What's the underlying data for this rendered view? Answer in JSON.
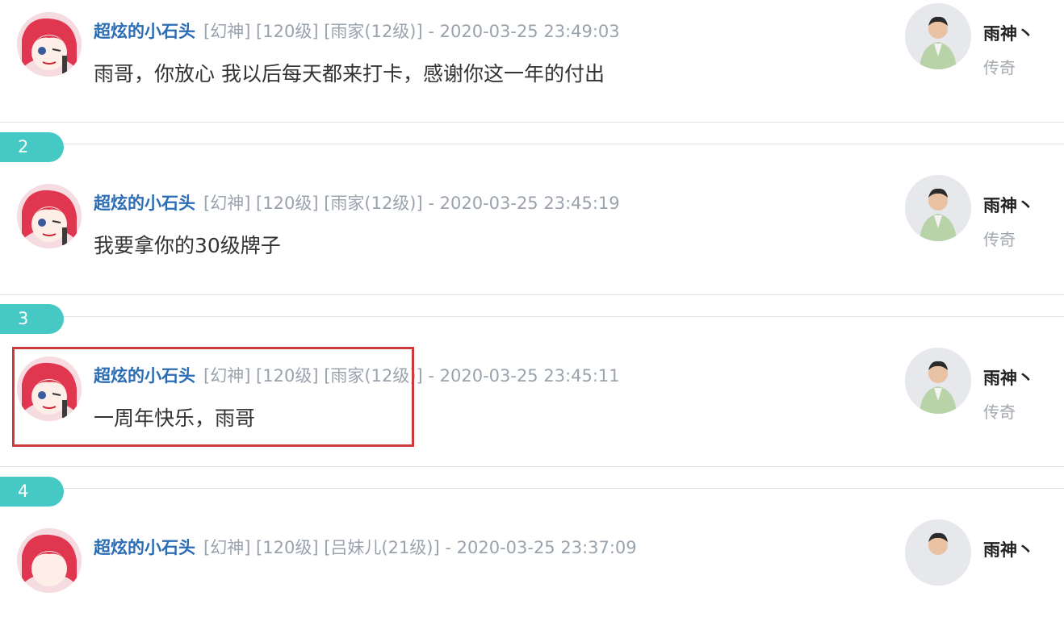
{
  "colors": {
    "username": "#2b6db5",
    "meta": "#9aa3ad",
    "badge": "#46c9c4",
    "highlight": "#cc3b3b"
  },
  "posts": [
    {
      "username": "超炫的小石头",
      "tags": "[幻神] [120级] [雨家(12级)] - 2020-03-25 23:49:03",
      "content": "雨哥，你放心 我以后每天都来打卡，感谢你这一年的付出",
      "reply_name": "雨神丶",
      "reply_title": "传奇"
    },
    {
      "floor": "2",
      "username": "超炫的小石头",
      "tags": "[幻神] [120级] [雨家(12级)] - 2020-03-25 23:45:19",
      "content": "我要拿你的30级牌子",
      "reply_name": "雨神丶",
      "reply_title": "传奇"
    },
    {
      "floor": "3",
      "username": "超炫的小石头",
      "tags": "[幻神] [120级] [雨家(12级)] - 2020-03-25 23:45:11",
      "content": "一周年快乐，雨哥",
      "reply_name": "雨神丶",
      "reply_title": "传奇",
      "highlighted": true
    },
    {
      "floor": "4",
      "username": "超炫的小石头",
      "tags": "[幻神] [120级] [吕妹儿(21级)] - 2020-03-25 23:37:09",
      "content": "",
      "reply_name": "雨神丶",
      "reply_title": ""
    }
  ]
}
